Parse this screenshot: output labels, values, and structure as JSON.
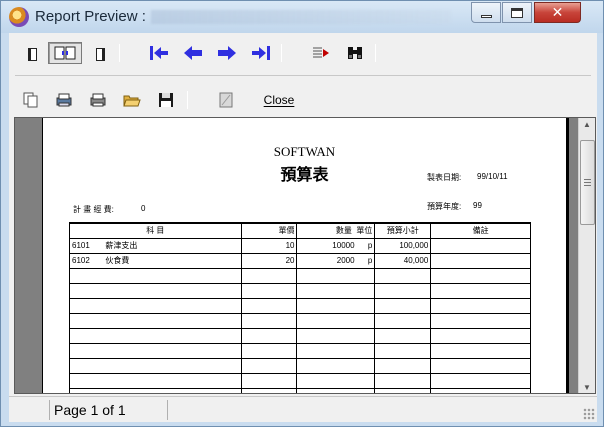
{
  "window": {
    "title": "Report Preview :",
    "colors": {
      "titlebar": "#c9dcef",
      "close_button": "#c8443a",
      "nav_arrow": "#2f2fe0"
    }
  },
  "toolbar_row1": {
    "items": [
      {
        "name": "single-page-view-button",
        "icon": "page-left-icon"
      },
      {
        "name": "two-page-view-button",
        "icon": "two-page-icon"
      },
      {
        "name": "page-width-button",
        "icon": "page-right-icon"
      },
      {
        "name": "first-page-button",
        "icon": "arrow-to-first-icon"
      },
      {
        "name": "previous-page-button",
        "icon": "arrow-left-icon"
      },
      {
        "name": "next-page-button",
        "icon": "arrow-right-icon"
      },
      {
        "name": "last-page-button",
        "icon": "arrow-to-last-icon"
      },
      {
        "name": "goto-page-button",
        "icon": "page-arrow-icon"
      },
      {
        "name": "find-button",
        "icon": "binoculars-icon"
      }
    ]
  },
  "toolbar_row2": {
    "close_label": "Close",
    "items": [
      {
        "name": "copy-button",
        "icon": "copy-pages-icon"
      },
      {
        "name": "printer-setup-button",
        "icon": "printer-setup-icon"
      },
      {
        "name": "print-button",
        "icon": "printer-icon"
      },
      {
        "name": "open-button",
        "icon": "open-folder-icon"
      },
      {
        "name": "save-button",
        "icon": "floppy-disk-icon"
      },
      {
        "name": "export-button",
        "icon": "document-icon"
      }
    ]
  },
  "report": {
    "company": "SOFTWAN",
    "title": "預算表",
    "report_date_label": "製表日期:",
    "report_date": "99/10/11",
    "budget_year_label": "預算年度:",
    "budget_year": "99",
    "manager_label": "計 畫 經 費:",
    "manager_value": "0",
    "columns": [
      "科 目",
      "單價",
      "數量",
      "單位",
      "預算小計",
      "備註"
    ],
    "rows": [
      {
        "code": "6101",
        "name": "薪津支出",
        "unit_price": "10",
        "qty": "10000",
        "unit": "p",
        "subtotal": "100,000",
        "note": ""
      },
      {
        "code": "6102",
        "name": "伙食費",
        "unit_price": "20",
        "qty": "2000",
        "unit": "p",
        "subtotal": "40,000",
        "note": ""
      }
    ],
    "empty_rows": 9
  },
  "status": {
    "page_text": "Page 1 of 1"
  }
}
